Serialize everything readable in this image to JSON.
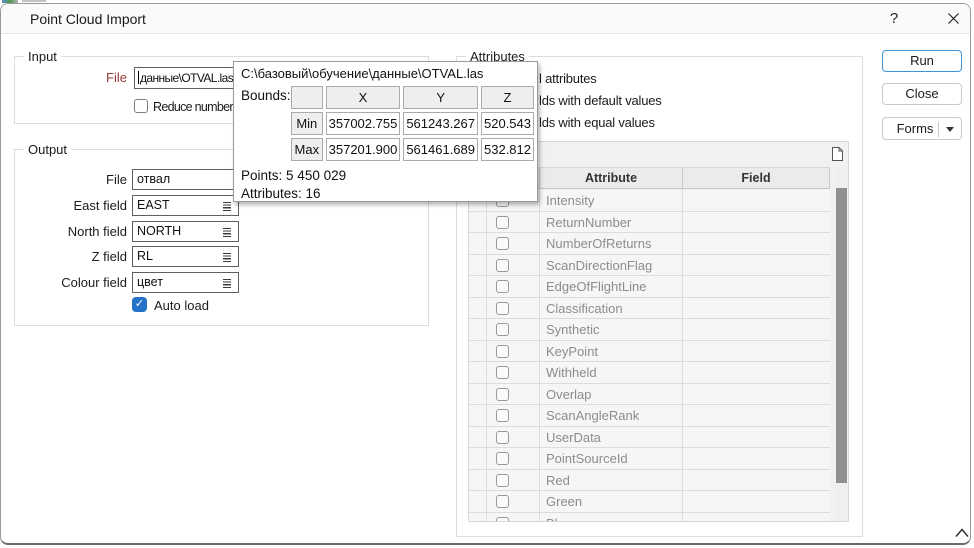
{
  "window": {
    "title": "Point Cloud Import",
    "help": "?",
    "close": "✕"
  },
  "input_group": {
    "label": "Input",
    "file_label": "File",
    "file_value": "данные\\OTVAL.las",
    "reduce_label": "Reduce number"
  },
  "output_group": {
    "label": "Output",
    "fields": [
      {
        "label": "File",
        "value": "отвал",
        "combo": false
      },
      {
        "label": "East field",
        "value": "EAST",
        "combo": true
      },
      {
        "label": "North field",
        "value": "NORTH",
        "combo": true
      },
      {
        "label": "Z field",
        "value": "RL",
        "combo": true
      },
      {
        "label": "Colour field",
        "value": "цвет",
        "combo": true
      }
    ],
    "auto_load_label": "Auto load",
    "auto_load_checked": true
  },
  "tooltip": {
    "path": "C:\\базовый\\обучение\\данные\\OTVAL.las",
    "bounds_label": "Bounds:",
    "columns": [
      "X",
      "Y",
      "Z"
    ],
    "rows": [
      {
        "label": "Min",
        "values": [
          "357002.755",
          "561243.267",
          "520.543"
        ]
      },
      {
        "label": "Max",
        "values": [
          "357201.900",
          "561461.689",
          "532.812"
        ]
      }
    ],
    "points_label": "Points:",
    "points_value": "5 450 029",
    "attributes_label": "Attributes:",
    "attributes_value": "16"
  },
  "attributes_group": {
    "label": "Attributes",
    "option_fragments": [
      "l attributes",
      "lds with default values",
      "lds with equal values"
    ],
    "grid": {
      "headers": [
        "Attribute",
        "Field"
      ],
      "rows": [
        "Intensity",
        "ReturnNumber",
        "NumberOfReturns",
        "ScanDirectionFlag",
        "EdgeOfFlightLine",
        "Classification",
        "Synthetic",
        "KeyPoint",
        "Withheld",
        "Overlap",
        "ScanAngleRank",
        "UserData",
        "PointSourceId",
        "Red",
        "Green",
        "Blue"
      ]
    }
  },
  "buttons": {
    "run": "Run",
    "close": "Close",
    "forms": "Forms"
  },
  "colors": {
    "accent": "#2573c9",
    "required_label": "#943c35"
  }
}
